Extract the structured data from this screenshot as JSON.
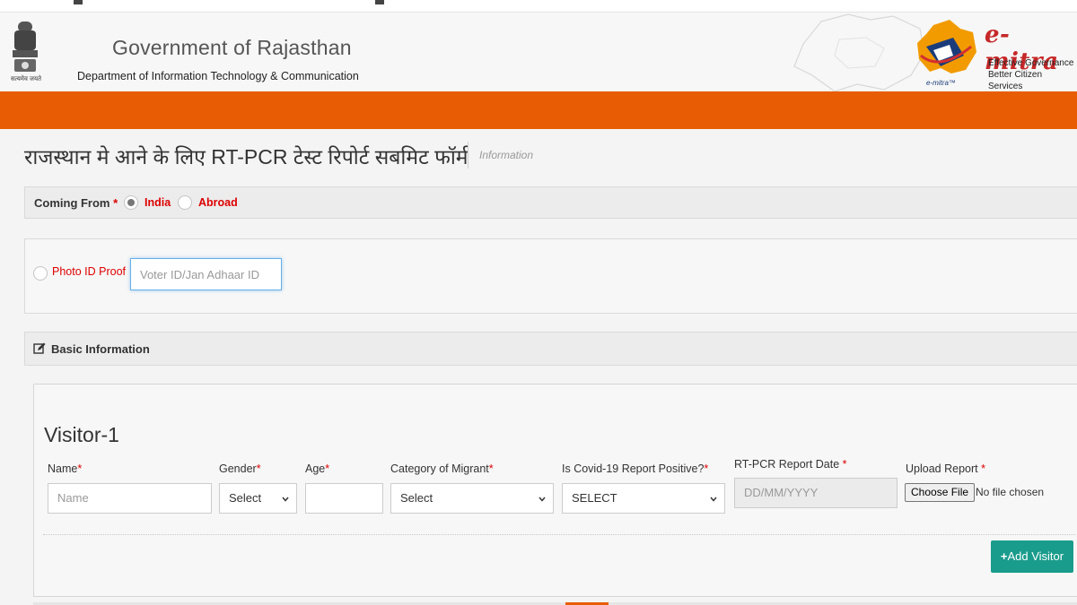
{
  "header": {
    "gov_title": "Government of Rajasthan",
    "dept_title": "Department of Information Technology & Communication",
    "emblem_motto": "सत्यमेव जयते",
    "emitra_name": "e-mitra",
    "emitra_tagline_1": "Effective Governance",
    "emitra_tagline_2": "Better Citizen Services",
    "emitra_small": "e-mitra™",
    "brand_orange": "#e85d04"
  },
  "page": {
    "title": "राजस्थान मे आने के लिए RT-PCR टेस्ट रिपोर्ट सबमिट फॉर्म",
    "subtitle": "Information"
  },
  "coming_from": {
    "label": "Coming From",
    "required_mark": "*",
    "options": [
      "India",
      "Abroad"
    ],
    "selected": "India"
  },
  "photo_id": {
    "label": "Photo ID Proof",
    "placeholder": "Voter ID/Jan Adhaar ID",
    "value": ""
  },
  "basic_info": {
    "title": "Basic Information",
    "icon": "edit-icon"
  },
  "visitor": {
    "title": "Visitor-1",
    "fields": {
      "name_label": "Name",
      "name_placeholder": "Name",
      "gender_label": "Gender",
      "gender_value": "Select",
      "age_label": "Age",
      "age_value": "",
      "category_label": "Category of Migrant",
      "category_value": "Select",
      "covid_label": "Is Covid-19 Report Positive?",
      "covid_value": "SELECT",
      "date_label": "RT-PCR Report Date",
      "date_placeholder": "DD/MM/YYYY",
      "upload_label": "Upload Report",
      "file_button": "Choose File",
      "file_status": "No file chosen"
    },
    "required_mark": "*",
    "add_button": "Add Visitor",
    "add_icon": "+",
    "accent": "#1a9c8c"
  }
}
